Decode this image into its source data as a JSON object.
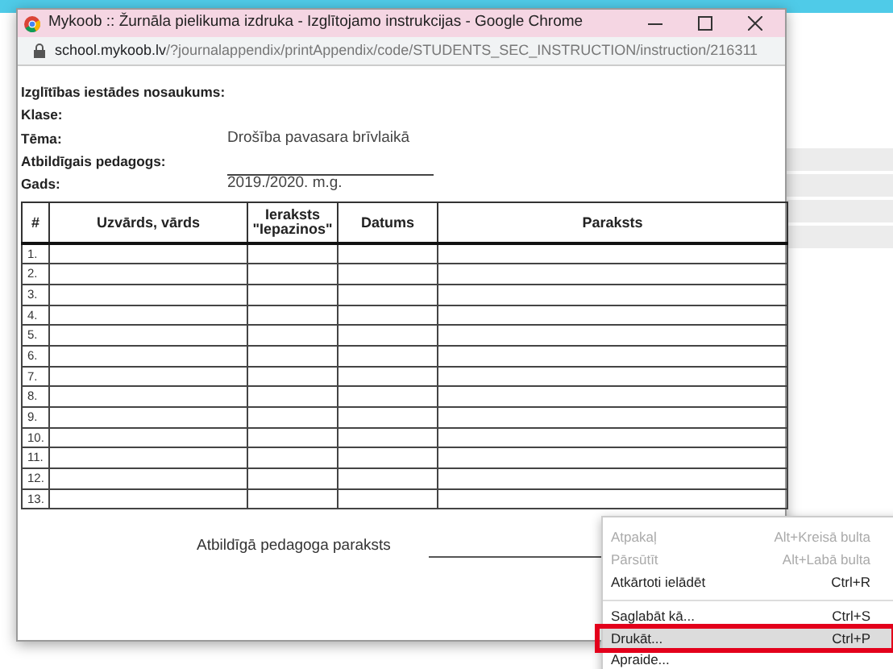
{
  "window": {
    "title": "Mykoob :: Žurnāla pielikuma izdruka - Izglītojamo instrukcijas - Google Chrome",
    "url": {
      "host": "school.mykoob.lv",
      "path": "/?journalappendix/printAppendix/code/STUDENTS_SEC_INSTRUCTION/instruction/216311"
    }
  },
  "form_fields": [
    {
      "label": "Izglītības iestādes nosaukums:",
      "kind": "text"
    },
    {
      "label": "Klase:",
      "kind": "text"
    },
    {
      "label": "Tēma:",
      "value": "Drošība pavasara brīvlaikā",
      "kind": "text"
    },
    {
      "label": "Atbildīgais pedagogs:",
      "kind": "line"
    },
    {
      "label": "Gads:",
      "value": "2019./2020. m.g.",
      "kind": "text"
    }
  ],
  "table": {
    "columns": [
      "#",
      "Uzvārds, vārds",
      "Ieraksts \"Iepazinos\"",
      "Datums",
      "Paraksts"
    ],
    "rows": [
      "1.",
      "2.",
      "3.",
      "4.",
      "5.",
      "6.",
      "7.",
      "8.",
      "9.",
      "10.",
      "11.",
      "12.",
      "13."
    ]
  },
  "signature_label": "Atbildīgā pedagoga paraksts",
  "context_menu": [
    {
      "kind": "item",
      "label": "Atpakaļ",
      "shortcut": "Alt+Kreisā bulta",
      "disabled": true,
      "selected": false
    },
    {
      "kind": "item",
      "label": "Pārsūtīt",
      "shortcut": "Alt+Labā bulta",
      "disabled": true,
      "selected": false
    },
    {
      "kind": "item",
      "label": "Atkārtoti ielādēt",
      "shortcut": "Ctrl+R",
      "disabled": false,
      "selected": false
    },
    {
      "kind": "divider"
    },
    {
      "kind": "item",
      "label": "Saglabāt kā...",
      "shortcut": "Ctrl+S",
      "disabled": false,
      "selected": false
    },
    {
      "kind": "item",
      "label": "Drukāt...",
      "shortcut": "Ctrl+P",
      "disabled": false,
      "selected": true
    },
    {
      "kind": "item",
      "label": "Apraide...",
      "disabled": false,
      "selected": false
    }
  ]
}
